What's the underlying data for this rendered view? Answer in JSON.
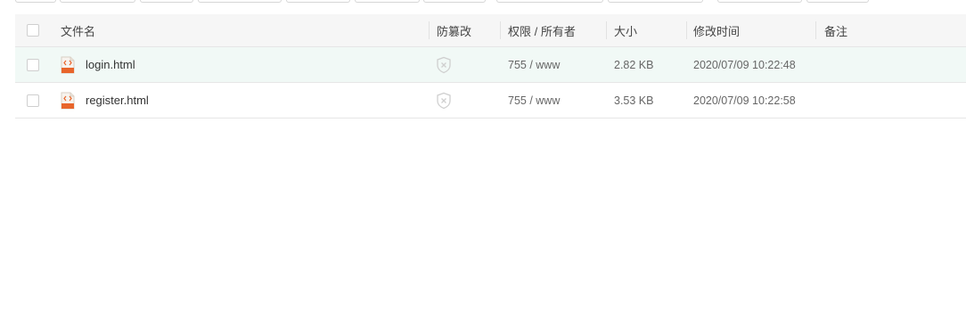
{
  "header": {
    "name": "文件名",
    "tamper": "防篡改",
    "perm_owner": "权限 / 所有者",
    "size": "大小",
    "mtime": "修改时间",
    "note": "备注"
  },
  "files": [
    {
      "name": "login.html",
      "perm": "755 / www",
      "size": "2.82 KB",
      "mtime": "2020/07/09 10:22:48",
      "note": "",
      "icon": "html-file-icon",
      "tamper_icon": "shield-x-icon"
    },
    {
      "name": "register.html",
      "perm": "755 / www",
      "size": "3.53 KB",
      "mtime": "2020/07/09 10:22:58",
      "note": "",
      "icon": "html-file-icon",
      "tamper_icon": "shield-x-icon"
    }
  ],
  "colors": {
    "header_bg": "#f6f6f6",
    "selected_row_bg": "#f1f9f6",
    "html_icon_orange": "#e8652b"
  }
}
